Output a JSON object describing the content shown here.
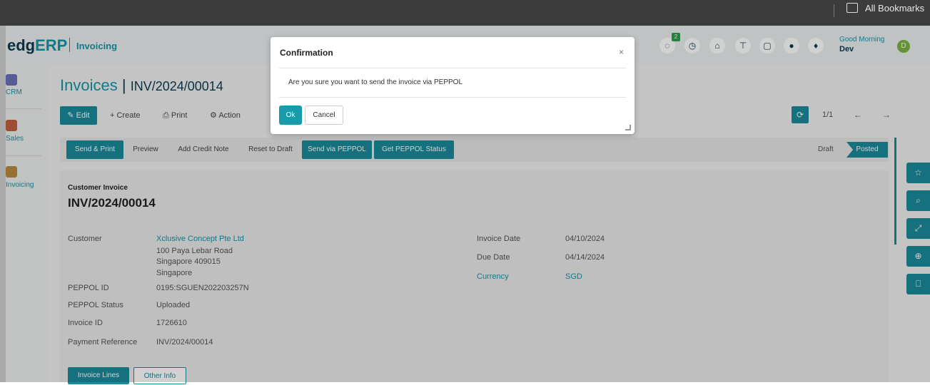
{
  "browser": {
    "bookmarks_label": "All Bookmarks"
  },
  "header": {
    "logo_main": "edg",
    "logo_accent": "ERP",
    "module": "Invoicing",
    "notification_count": "2",
    "greeting": "Good Morning",
    "user_name": "Dev",
    "avatar_initial": "D"
  },
  "sidenav": {
    "items": [
      {
        "label": "CRM"
      },
      {
        "label": "Sales"
      },
      {
        "label": "Invoicing"
      }
    ]
  },
  "page": {
    "title": "Invoices",
    "separator": "|",
    "record_ref": "INV/2024/00014"
  },
  "toolbar": {
    "edit_label": "Edit",
    "create_label": "+ Create",
    "print_label": "Print",
    "action_label": "Action"
  },
  "pager": {
    "text": "1/1",
    "prev": "←",
    "next": "→"
  },
  "status_buttons": {
    "send_print": "Send & Print",
    "preview": "Preview",
    "add_credit_note": "Add Credit Note",
    "reset_to_draft": "Reset to Draft",
    "send_peppol": "Send via PEPPOL",
    "get_peppol_status": "Get PEPPOL Status"
  },
  "stages": {
    "draft": "Draft",
    "posted": "Posted"
  },
  "invoice": {
    "type_label": "Customer Invoice",
    "number": "INV/2024/00014",
    "fields_left": [
      {
        "label": "Customer",
        "value": "Xclusive Concept Pte Ltd"
      },
      {
        "label": "PEPPOL ID",
        "value": "0195:SGUEN202203257N"
      },
      {
        "label": "PEPPOL Status",
        "value": "Uploaded"
      },
      {
        "label": "Invoice ID",
        "value": "1726610"
      },
      {
        "label": "Payment Reference",
        "value": "INV/2024/00014"
      }
    ],
    "address_lines": [
      "100 Paya Lebar Road",
      "Singapore 409015",
      "Singapore"
    ],
    "fields_right": [
      {
        "label": "Invoice Date",
        "value": "04/10/2024"
      },
      {
        "label": "Due Date",
        "value": "04/14/2024"
      },
      {
        "label": "Currency",
        "value": "SGD"
      }
    ]
  },
  "tabs": {
    "invoice_lines": "Invoice Lines",
    "other_info": "Other Info"
  },
  "modal": {
    "title": "Confirmation",
    "close": "×",
    "message": "Are you sure you want to send the invoice via PEPPOL",
    "ok_label": "Ok",
    "cancel_label": "Cancel"
  },
  "colors": {
    "accent": "#1a8a99",
    "brand_dark": "#0d3b4f",
    "link": "#1595a8"
  }
}
